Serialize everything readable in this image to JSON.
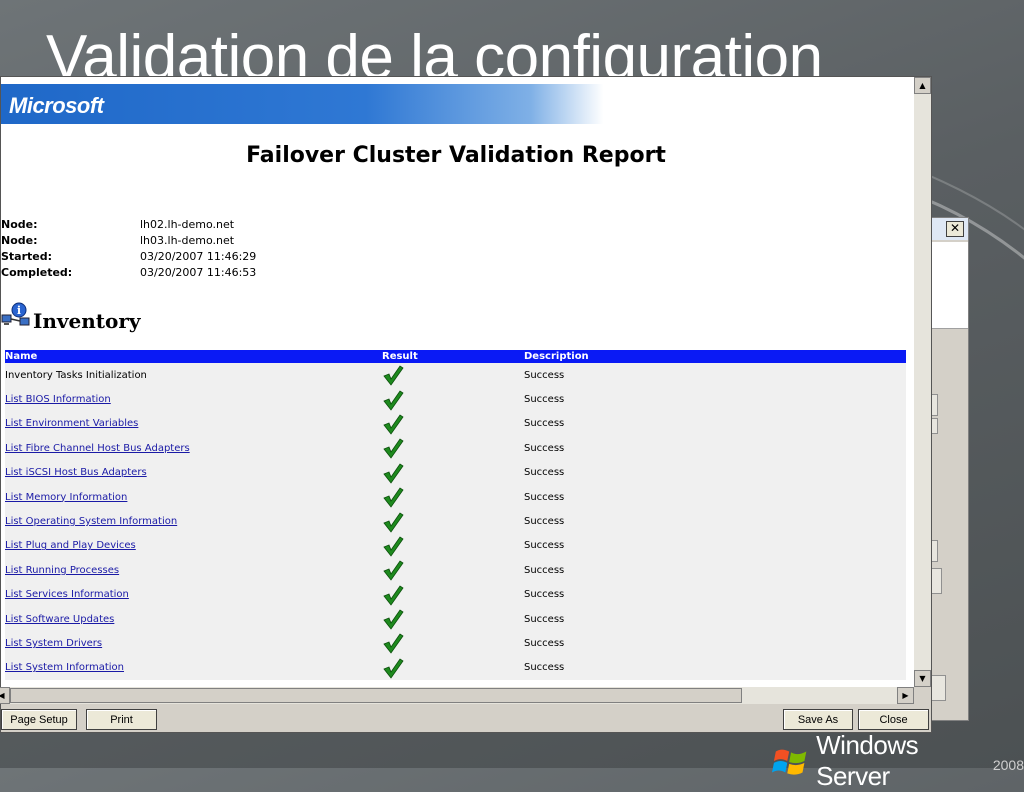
{
  "slide": {
    "title": "Validation de la configuration"
  },
  "report": {
    "logo": "Microsoft",
    "title": "Failover Cluster Validation Report",
    "meta": [
      {
        "label": "Node:",
        "value": "lh02.lh-demo.net"
      },
      {
        "label": "Node:",
        "value": "lh03.lh-demo.net"
      },
      {
        "label": "Started:",
        "value": "03/20/2007 11:46:29"
      },
      {
        "label": "Completed:",
        "value": "03/20/2007 11:46:53"
      }
    ],
    "section_title": "Inventory",
    "columns": {
      "name": "Name",
      "result": "Result",
      "description": "Description"
    },
    "rows": [
      {
        "name": "Inventory Tasks Initialization",
        "result": "pass",
        "description": "Success",
        "link": false
      },
      {
        "name": "List BIOS Information",
        "result": "pass",
        "description": "Success",
        "link": true
      },
      {
        "name": "List Environment Variables",
        "result": "pass",
        "description": "Success",
        "link": true
      },
      {
        "name": "List Fibre Channel Host Bus Adapters",
        "result": "pass",
        "description": "Success",
        "link": true
      },
      {
        "name": "List iSCSI Host Bus Adapters",
        "result": "pass",
        "description": "Success",
        "link": true
      },
      {
        "name": "List Memory Information",
        "result": "pass",
        "description": "Success",
        "link": true
      },
      {
        "name": "List Operating System Information",
        "result": "pass",
        "description": "Success",
        "link": true
      },
      {
        "name": "List Plug and Play Devices",
        "result": "pass",
        "description": "Success",
        "link": true
      },
      {
        "name": "List Running Processes",
        "result": "pass",
        "description": "Success",
        "link": true
      },
      {
        "name": "List Services Information",
        "result": "pass",
        "description": "Success",
        "link": true
      },
      {
        "name": "List Software Updates",
        "result": "pass",
        "description": "Success",
        "link": true
      },
      {
        "name": "List System Drivers",
        "result": "pass",
        "description": "Success",
        "link": true
      },
      {
        "name": "List System Information",
        "result": "pass",
        "description": "Success",
        "link": true
      }
    ]
  },
  "buttons": {
    "page_setup": "Page Setup",
    "print": "Print",
    "save_as": "Save As",
    "close": "Close"
  },
  "branding": {
    "windows_server": "Windows Server",
    "year": "2008"
  },
  "colors": {
    "header_row": "#0a1af5",
    "link": "#1a1aa6",
    "check": "#1e8a1e",
    "banner": "#1f68c8"
  },
  "icons": {
    "section": "inventory-network-icon",
    "result": "green-check-icon"
  }
}
